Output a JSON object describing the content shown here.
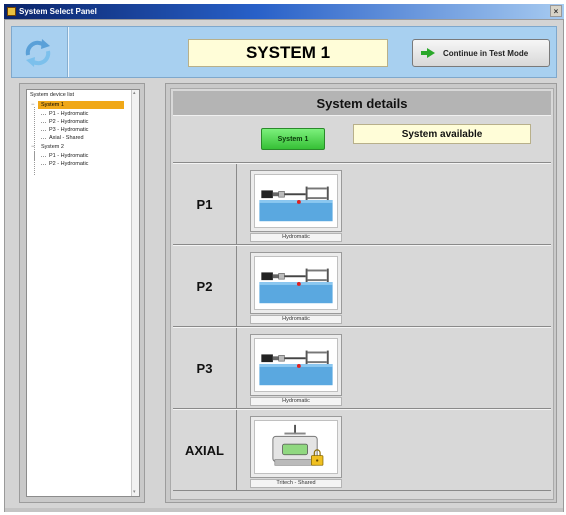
{
  "window": {
    "title": "System Select Panel",
    "close_glyph": "×"
  },
  "header": {
    "refresh_icon": "refresh-arrows-icon",
    "system_title": "SYSTEM 1",
    "continue_button": "Continue in Test Mode",
    "continue_icon": "green-arrow-icon"
  },
  "tree": {
    "header": "System device list",
    "items": [
      {
        "label": "System 1",
        "level": 0,
        "expanded": true,
        "selected": true
      },
      {
        "label": "P1 - Hydromatic",
        "level": 1
      },
      {
        "label": "P2 - Hydromatic",
        "level": 1
      },
      {
        "label": "P3 - Hydromatic",
        "level": 1
      },
      {
        "label": "Axial - Shared",
        "level": 1
      },
      {
        "label": "System 2",
        "level": 0,
        "expanded": true,
        "selected": false
      },
      {
        "label": "P1 - Hydromatic",
        "level": 1
      },
      {
        "label": "P2 - Hydromatic",
        "level": 1
      }
    ]
  },
  "details": {
    "heading": "System details",
    "system_badge": "System 1",
    "availability": "System available",
    "devices": [
      {
        "name": "P1",
        "caption": "Hydromatic",
        "kind": "hydromatic"
      },
      {
        "name": "P2",
        "caption": "Hydromatic",
        "kind": "hydromatic"
      },
      {
        "name": "P3",
        "caption": "Hydromatic",
        "kind": "hydromatic"
      },
      {
        "name": "AXIAL",
        "caption": "Tritech - Shared",
        "kind": "shared"
      }
    ]
  },
  "colors": {
    "header_bg": "#a8d0f0",
    "title_box": "#fffdd8",
    "badge_green": "#36c036",
    "tree_selected": "#f0a818",
    "water": "#5aa8e0"
  }
}
